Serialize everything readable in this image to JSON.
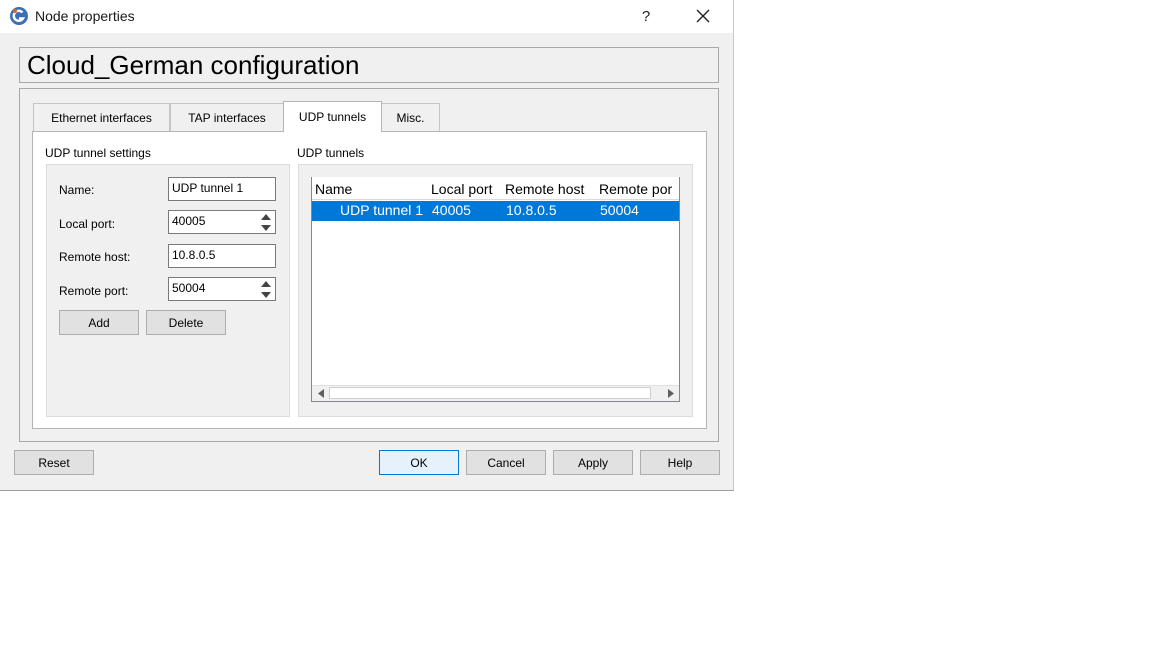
{
  "window": {
    "title": "Node properties",
    "help_label": "?"
  },
  "heading": "Cloud_German configuration",
  "tabs": [
    {
      "label": "Ethernet interfaces",
      "active": false
    },
    {
      "label": "TAP interfaces",
      "active": false
    },
    {
      "label": "UDP tunnels",
      "active": true
    },
    {
      "label": "Misc.",
      "active": false
    }
  ],
  "settings": {
    "group_label": "UDP tunnel settings",
    "name_label": "Name:",
    "name_value": "UDP tunnel 1",
    "local_port_label": "Local port:",
    "local_port_value": "40005",
    "remote_host_label": "Remote host:",
    "remote_host_value": "10.8.0.5",
    "remote_port_label": "Remote port:",
    "remote_port_value": "50004",
    "add_label": "Add",
    "delete_label": "Delete"
  },
  "tunnels": {
    "group_label": "UDP tunnels",
    "columns": [
      "Name",
      "Local port",
      "Remote host",
      "Remote por"
    ],
    "rows": [
      [
        "UDP tunnel 1",
        "40005",
        "10.8.0.5",
        "50004"
      ]
    ]
  },
  "footer": {
    "reset_label": "Reset",
    "ok_label": "OK",
    "cancel_label": "Cancel",
    "apply_label": "Apply",
    "help_label": "Help"
  },
  "colors": {
    "selection": "#0078d7",
    "window_bg": "#f0f0f0",
    "default_button_border": "#0078d7"
  },
  "icons": [
    "app-icon",
    "close-icon",
    "spin-up-icon",
    "spin-down-icon",
    "scroll-left-icon",
    "scroll-right-icon"
  ]
}
